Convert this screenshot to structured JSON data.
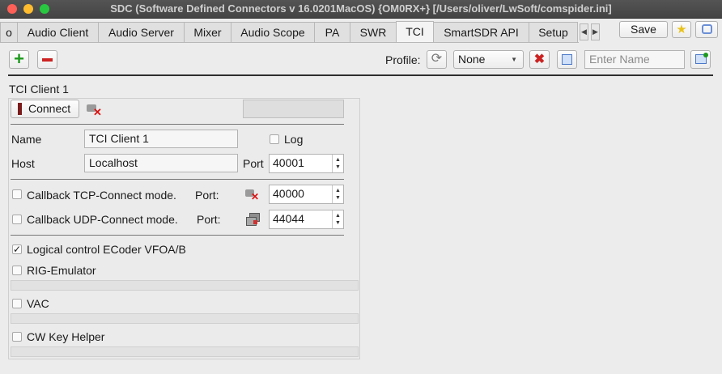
{
  "window": {
    "title": "SDC (Software Defined Connectors v 16.0201MacOS) {OM0RX+} [/Users/oliver/LwSoft/comspider.ini]"
  },
  "tabs": [
    "o",
    "Audio Client",
    "Audio Server",
    "Mixer",
    "Audio Scope",
    "PA",
    "SWR",
    "TCI",
    "SmartSDR API",
    "Setup"
  ],
  "active_tab": "TCI",
  "toolbar": {
    "save_label": "Save",
    "profile_label": "Profile:",
    "profile_value": "None",
    "name_placeholder": "Enter Name"
  },
  "client": {
    "section_title": "TCI Client 1",
    "connect_label": "Connect",
    "name_label": "Name",
    "name_value": "TCI Client 1",
    "log_label": "Log",
    "host_label": "Host",
    "host_value": "Localhost",
    "port_label": "Port",
    "port_value": "40001",
    "tcp_label": "Callback TCP-Connect mode.",
    "tcp_port_label": "Port:",
    "tcp_port_value": "40000",
    "udp_label": "Callback UDP-Connect mode.",
    "udp_port_label": "Port:",
    "udp_port_value": "44044",
    "logical_label": "Logical control ECoder VFOA/B",
    "logical_checked": true,
    "rig_label": "RIG-Emulator",
    "vac_label": "VAC",
    "cw_label": "CW Key Helper"
  },
  "colors": {
    "add": "#1d9a1d",
    "remove": "#cc2222",
    "connect_indicator": "#7a1c1c"
  }
}
